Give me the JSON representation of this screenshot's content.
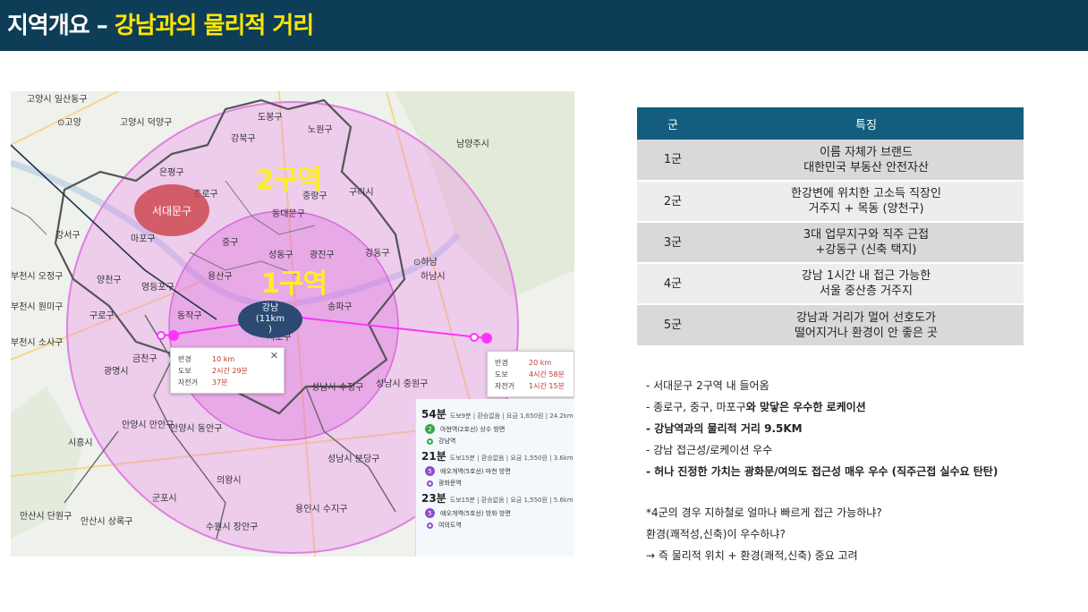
{
  "header": {
    "title_prefix": "지역개요 – ",
    "title_highlight": "강남과의 물리적 거리"
  },
  "map": {
    "zone2_label": "2구역",
    "zone1_label": "1구역",
    "seodaemun_bubble": "서대문구",
    "gangnam_bubble_line1": "강남",
    "gangnam_bubble_line2": "(11km",
    "gangnam_bubble_line3": ")",
    "labels": {
      "goyang_ilsan": "고양시 일산동구",
      "goyang": "⊙고양",
      "goyang_deokyang": "고양시 덕양구",
      "dobong": "도봉구",
      "nowon": "노원구",
      "gangbuk": "강북구",
      "namyangju": "남양주시",
      "eunpyeong": "은평구",
      "jongno": "종로구",
      "jungnang": "중랑구",
      "guri": "구리시",
      "dongdaemun": "동대문구",
      "gangseo": "강서구",
      "mapo": "마포구",
      "jung": "중구",
      "seongdong": "성동구",
      "gwangjin": "광진구",
      "gangdong": "강동구",
      "bucheon_ojeong": "부천시 오정구",
      "yangcheon": "양천구",
      "yongsan": "용산구",
      "hanam": "하남시",
      "yeongdeungpo": "영등포구",
      "bucheon_wonmi": "부천시 원미구",
      "guro": "구로구",
      "dongjak": "동작구",
      "songpa": "송파구",
      "bucheon_sosa": "부천시 소사구",
      "seocho": "서초구",
      "geumcheon": "금천구",
      "gwangmyeong": "광명시",
      "seongnam_sujeong": "성남시 수정구",
      "seongnam_jungwon": "성남시 중원구",
      "anyang_manan": "안양시 만안구",
      "anyang_dongan": "안양시 동안구",
      "siheung": "시흥시",
      "uiwang": "의왕시",
      "seongnam_bundang": "성남시 분당구",
      "gunpo": "군포시",
      "ansan_danwon": "안산시 단원구",
      "ansan_sangrok": "안산시 상록구",
      "suwon_jangan": "수원시 장안구",
      "yongin_suji": "용인시 수지구",
      "hanam_small": "⊙하남"
    },
    "popup_left": {
      "radius_k": "반경",
      "radius_v": "10 km",
      "walk_k": "도보",
      "walk_v": "2시간 29분",
      "bike_k": "자전거",
      "bike_v": "37분",
      "close": "✕"
    },
    "popup_right": {
      "radius_k": "반경",
      "radius_v": "20 km",
      "walk_k": "도보",
      "walk_v": "4시간 58분",
      "bike_k": "자전거",
      "bike_v": "1시간 15분"
    },
    "transit": [
      {
        "time": "54분",
        "meta": "도보9분 | 환승없음 | 요금 1,650원 | 24.2km",
        "line_badge": "2",
        "board": "아현역(2호선) 상수 방면",
        "alight": "강남역"
      },
      {
        "time": "21분",
        "meta": "도보15분 | 환승없음 | 요금 1,550원 | 3.6km",
        "line_badge": "5",
        "board": "애오개역(5호선) 마천 방면",
        "alight": "광화문역"
      },
      {
        "time": "23분",
        "meta": "도보15분 | 환승없음 | 요금 1,550원 | 5.6km",
        "line_badge": "5",
        "board": "애오개역(5호선) 방화 방면",
        "alight": "여의도역"
      }
    ]
  },
  "table": {
    "headers": [
      "군",
      "특징"
    ],
    "rows": [
      {
        "group": "1군",
        "line1": "이름 자체가 브랜드",
        "line2": "대한민국 부동산 안전자산"
      },
      {
        "group": "2군",
        "line1": "한강변에 위치한 고소득 직장인",
        "line2": "거주지 + 목동 (양천구)"
      },
      {
        "group": "3군",
        "line1": "3대 업무지구와 직주 근접",
        "line2": "+강동구 (신축 택지)"
      },
      {
        "group": "4군",
        "line1": "강남 1시간 내 접근 가능한",
        "line2": "서울 중산층 거주지"
      },
      {
        "group": "5군",
        "line1": "강남과 거리가 멀어 선호도가",
        "line2": "떨어지거나 환경이 안 좋은 곳"
      }
    ]
  },
  "notes": {
    "n1": "- 서대문구 2구역 내 들어옴",
    "n2a": "- 종로구, 중구, 마포구",
    "n2b": "와 맞닿은 우수한 로케이션",
    "n3": "- 강남역과의 물리적 거리 9.5KM",
    "n4": "- 강남 접근성/로케이션 우수",
    "n5": "- 허나 진정한 가치는 광화문/여의도 접근성 매우 우수 (직주근접 실수요 탄탄)",
    "q1": "*4군의 경우 지하철로 얼마나 빠르게 접근 가능하냐?",
    "q2": " 환경(쾌적성,신축)이 우수하냐?",
    "q3": "   → 즉 물리적 위치 + 환경(쾌적,신축) 중요 고려"
  }
}
